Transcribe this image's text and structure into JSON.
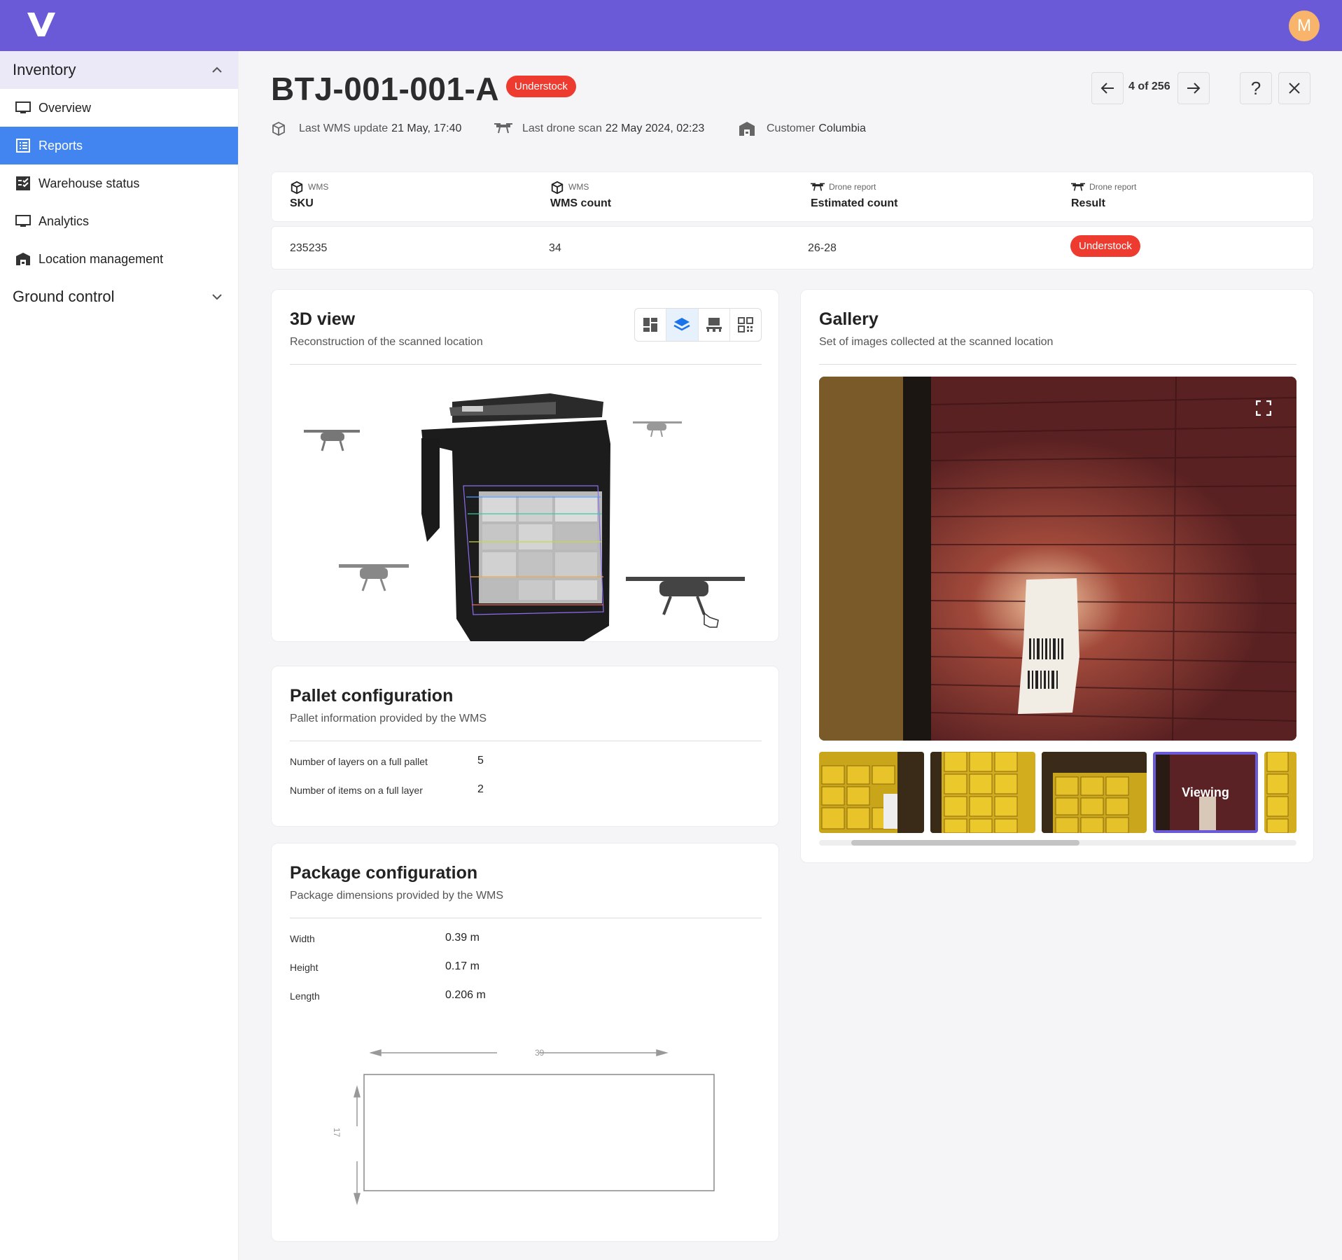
{
  "app": {
    "logo_letter": "V",
    "avatar_initial": "M",
    "brand_color": "#6a5ad8"
  },
  "sidebar": {
    "groups": [
      {
        "label": "Inventory",
        "expanded": true
      },
      {
        "label": "Ground control",
        "expanded": false
      }
    ],
    "items": [
      {
        "label": "Overview",
        "icon": "monitor-icon",
        "active": false
      },
      {
        "label": "Reports",
        "icon": "list-icon",
        "active": true
      },
      {
        "label": "Warehouse status",
        "icon": "checklist-icon",
        "active": false
      },
      {
        "label": "Analytics",
        "icon": "monitor-icon",
        "active": false
      },
      {
        "label": "Location management",
        "icon": "warehouse-icon",
        "active": false
      }
    ]
  },
  "header": {
    "location_id": "BTJ-001-001-A",
    "status_badge": "Understock",
    "pager": "4 of 256",
    "meta": [
      {
        "icon": "cube-icon",
        "label": "Last WMS update",
        "value": "21 May, 17:40"
      },
      {
        "icon": "drone-icon",
        "label": "Last drone scan",
        "value": "22 May 2024, 02:23"
      },
      {
        "icon": "warehouse-icon",
        "label": "Customer",
        "value": "Columbia"
      }
    ]
  },
  "summary": {
    "columns": [
      {
        "source": "WMS",
        "label": "SKU",
        "icon": "cube-icon"
      },
      {
        "source": "WMS",
        "label": "WMS count",
        "icon": "cube-icon"
      },
      {
        "source": "Drone report",
        "label": "Estimated count",
        "icon": "drone-icon"
      },
      {
        "source": "Drone report",
        "label": "Result",
        "icon": "drone-icon"
      }
    ],
    "row": {
      "sku": "235235",
      "wms_count": "34",
      "estimated_count": "26-28",
      "result": "Understock"
    }
  },
  "view3d": {
    "title": "3D view",
    "subtitle": "Reconstruction of the scanned location",
    "tools": [
      "grid-view-icon",
      "layers-icon",
      "pallet-icon",
      "qr-code-icon"
    ],
    "active_tool": 1
  },
  "gallery": {
    "title": "Gallery",
    "subtitle": "Set of images collected at the scanned location",
    "viewing_label": "Viewing",
    "thumbnail_count": 5,
    "active_thumbnail": 3
  },
  "pallet": {
    "title": "Pallet configuration",
    "subtitle": "Pallet information provided by the WMS",
    "rows": [
      {
        "label": "Number of layers on a full pallet",
        "value": "5"
      },
      {
        "label": "Number of items on a full layer",
        "value": "2"
      }
    ]
  },
  "package": {
    "title": "Package configuration",
    "subtitle": "Package dimensions provided by the WMS",
    "rows": [
      {
        "label": "Width",
        "value": "0.39 m"
      },
      {
        "label": "Height",
        "value": "0.17 m"
      },
      {
        "label": "Length",
        "value": "0.206 m"
      }
    ],
    "diagram": {
      "width_label": "39",
      "height_label": "17"
    }
  },
  "colors": {
    "accent": "#4285f0",
    "danger": "#ee3b2f",
    "viewing_border": "#6a5ad8"
  }
}
